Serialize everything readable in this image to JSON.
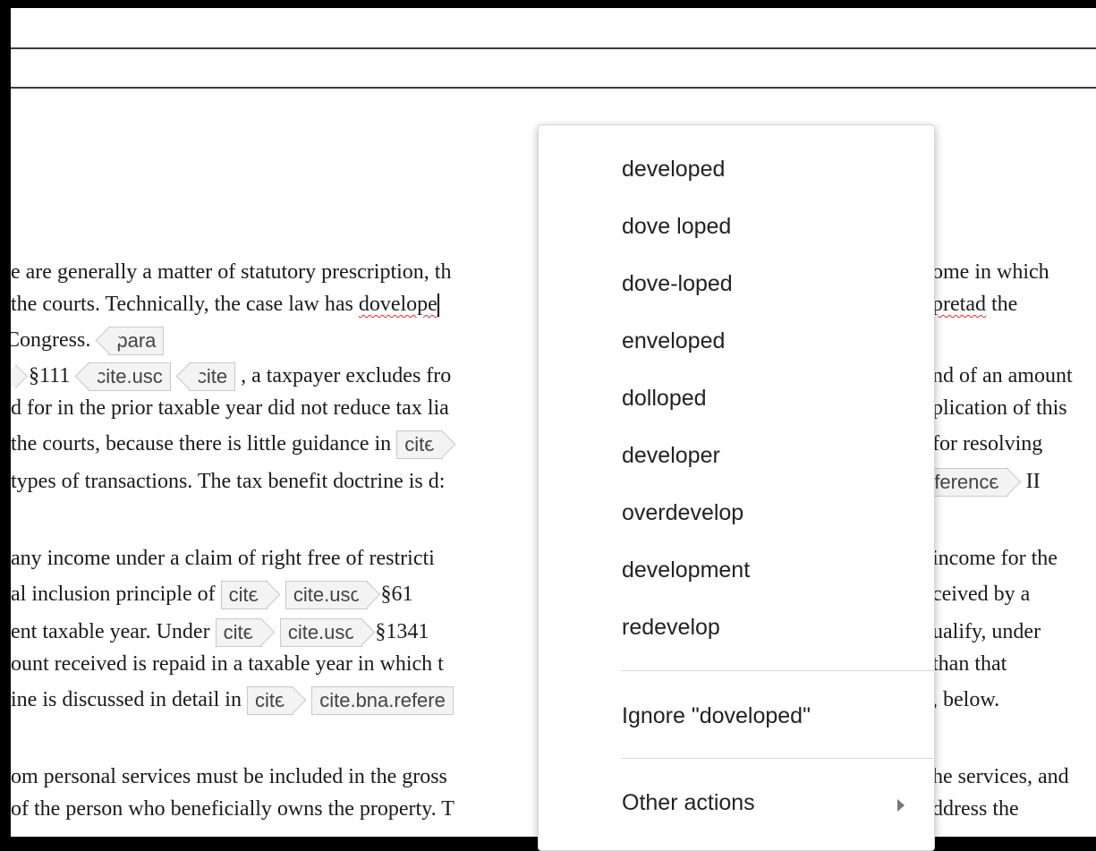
{
  "document": {
    "lines": [
      {
        "text": "e are generally a matter of statutory prescription, th"
      },
      {
        "text": "ome in which"
      },
      {
        "pre": " the courts. Technically, the case law has ",
        "misspelled": "dovelope"
      },
      {
        "misspelled": "pretad",
        "post": " the"
      },
      {
        "text": "Congress."
      },
      {
        "text": "§111"
      },
      {
        "text": ", a taxpayer excludes fro"
      },
      {
        "text": "nd of an amount"
      },
      {
        "text": "d for in the prior taxable year did not reduce tax lia"
      },
      {
        "text": "plication of this"
      },
      {
        "text": "the courts, because there is little guidance in"
      },
      {
        "text": "for resolving"
      },
      {
        "text": " types of transactions. The tax benefit doctrine is d:"
      },
      {
        "text": "II"
      },
      {
        "text": " any income under a claim of right free of restricti"
      },
      {
        "text": "income for the"
      },
      {
        "text": "al inclusion principle of"
      },
      {
        "text": "§61"
      },
      {
        "text": "ceived by a"
      },
      {
        "text": "ent taxable year. Under"
      },
      {
        "text": "§1341"
      },
      {
        "text": "ualify, under"
      },
      {
        "text": "ount received is repaid in a taxable year in which t"
      },
      {
        "text": "than that"
      },
      {
        "text": "ine is discussed in detail in"
      },
      {
        "text": ", below."
      },
      {
        "text": "om personal services must be included in the gross"
      },
      {
        "text": "he services, and"
      },
      {
        "text": "of the person who beneficially owns the property. T"
      },
      {
        "text": "ddress the"
      }
    ],
    "tags": {
      "para": "para",
      "cite": "cite",
      "cite_usc": "cite.usc",
      "reference_fragment": "eference",
      "cite_bna_fragment": "cite.bna.refere"
    }
  },
  "context_menu": {
    "suggestions": [
      "developed",
      "dove loped",
      "dove-loped",
      "enveloped",
      "dolloped",
      "developer",
      "overdevelop",
      "development",
      "redevelop"
    ],
    "ignore_label": "Ignore \"doveloped\"",
    "other_actions_label": "Other actions",
    "submenu_icon": "chevron-right-icon"
  }
}
